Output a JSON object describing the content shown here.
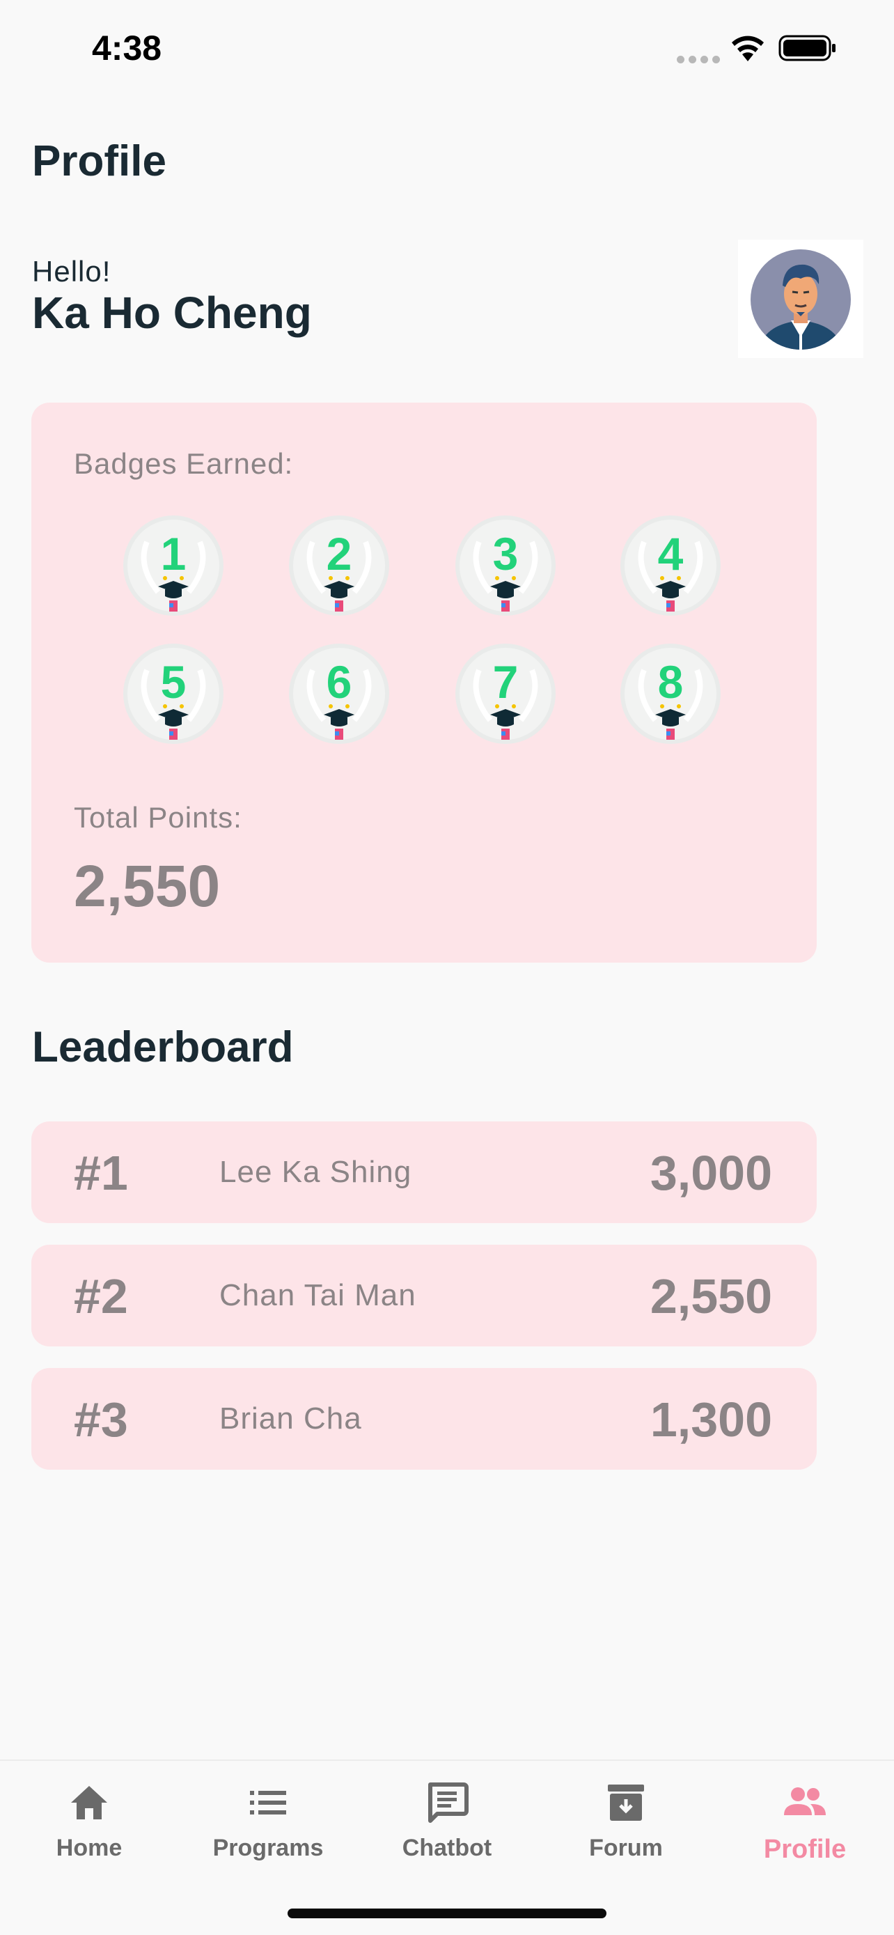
{
  "status_bar": {
    "time": "4:38"
  },
  "header": {
    "title": "Profile"
  },
  "user": {
    "greeting": "Hello!",
    "name": "Ka Ho Cheng"
  },
  "badges": {
    "label": "Badges Earned:",
    "items": [
      "1",
      "2",
      "3",
      "4",
      "5",
      "6",
      "7",
      "8"
    ]
  },
  "points": {
    "label": "Total Points:",
    "value": "2,550"
  },
  "leaderboard": {
    "title": "Leaderboard",
    "rows": [
      {
        "rank": "#1",
        "name": "Lee Ka Shing",
        "points": "3,000"
      },
      {
        "rank": "#2",
        "name": "Chan Tai Man",
        "points": "2,550"
      },
      {
        "rank": "#3",
        "name": "Brian Cha",
        "points": "1,300"
      }
    ]
  },
  "tabs": [
    {
      "label": "Home",
      "icon": "home-icon"
    },
    {
      "label": "Programs",
      "icon": "list-icon"
    },
    {
      "label": "Chatbot",
      "icon": "chat-icon"
    },
    {
      "label": "Forum",
      "icon": "archive-icon"
    },
    {
      "label": "Profile",
      "icon": "people-icon",
      "active": true
    }
  ],
  "colors": {
    "accent": "#f38aa3",
    "card": "#fde4e8",
    "muted_text": "#8b8486",
    "badge_number": "#22d27a"
  }
}
